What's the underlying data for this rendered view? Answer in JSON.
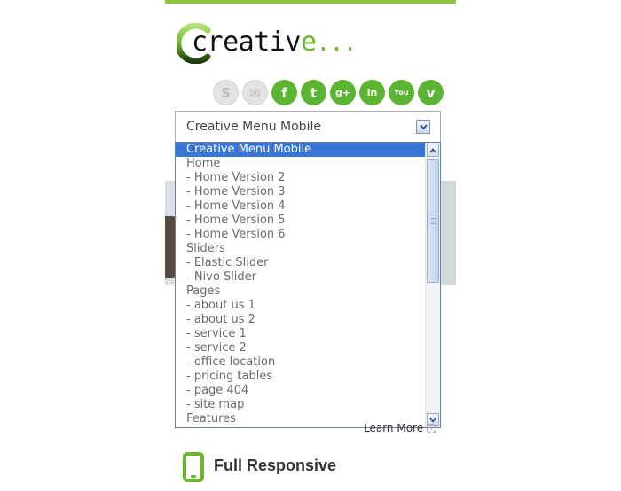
{
  "colors": {
    "brand_green": "#8dc63f",
    "icon_green": "#5bb533",
    "selection_blue": "#3875d7"
  },
  "logo": {
    "text_main": "creativ",
    "text_accent": "e",
    "text_dots": "..."
  },
  "social": [
    {
      "name": "skype-icon",
      "glyph": "S",
      "style": "grey"
    },
    {
      "name": "email-icon",
      "glyph": "✉",
      "style": "grey"
    },
    {
      "name": "facebook-icon",
      "glyph": "f",
      "style": "green"
    },
    {
      "name": "twitter-icon",
      "glyph": "t",
      "style": "green"
    },
    {
      "name": "google-plus-icon",
      "glyph": "g+",
      "style": "green"
    },
    {
      "name": "linkedin-icon",
      "glyph": "in",
      "style": "green"
    },
    {
      "name": "youtube-icon",
      "glyph": "You",
      "style": "green"
    },
    {
      "name": "vimeo-icon",
      "glyph": "v",
      "style": "green"
    }
  ],
  "menu_select": {
    "selected_value": "Creative Menu Mobile",
    "options": [
      "Creative Menu Mobile",
      "Home",
      "- Home Version 2",
      "- Home Version 3",
      "- Home Version 4",
      "- Home Version 5",
      "- Home Version 6",
      "Sliders",
      "- Elastic Slider",
      "- Nivo Slider",
      "Pages",
      "- about us 1",
      "- about us 2",
      "- service 1",
      "- service 2",
      "- office location",
      "- pricing tables",
      "- page 404",
      "- site map",
      "Features"
    ]
  },
  "learn_more": {
    "label": "Learn More"
  },
  "feature": {
    "title": "Full Responsive",
    "icon": "mobile-phone-icon"
  }
}
